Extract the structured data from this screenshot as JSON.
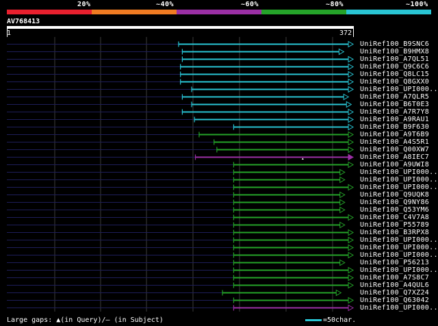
{
  "scale": {
    "labels": [
      "20%",
      "~40%",
      "~60%",
      "~80%",
      "~100%"
    ],
    "colors": [
      "#e8202e",
      "#f07b22",
      "#9a2fa4",
      "#25a329",
      "#29c5d4"
    ]
  },
  "query": {
    "title": "AV768413",
    "start": "1",
    "end": "372",
    "length": 372
  },
  "hits": [
    {
      "name": "UniRef100_B9SNC6",
      "start": 185,
      "end": 372,
      "color": "#29c5d4",
      "open": true
    },
    {
      "name": "UniRef100_B9HMX8",
      "start": 189,
      "end": 362,
      "color": "#29c5d4",
      "open": true
    },
    {
      "name": "UniRef100_A7QL51",
      "start": 189,
      "end": 372,
      "color": "#29c5d4",
      "open": true
    },
    {
      "name": "UniRef100_Q9C6C6",
      "start": 187,
      "end": 372,
      "color": "#29c5d4",
      "open": true
    },
    {
      "name": "UniRef100_Q8LC15",
      "start": 187,
      "end": 372,
      "color": "#29c5d4",
      "open": true
    },
    {
      "name": "UniRef100_Q8GXX0",
      "start": 187,
      "end": 372,
      "color": "#29c5d4",
      "open": true
    },
    {
      "name": "UniRef100_UPI000..",
      "start": 199,
      "end": 372,
      "color": "#29c5d4",
      "open": true
    },
    {
      "name": "UniRef100_A7QLR5",
      "start": 189,
      "end": 367,
      "color": "#29c5d4",
      "open": true
    },
    {
      "name": "UniRef100_B6T0E3",
      "start": 199,
      "end": 370,
      "color": "#29c5d4",
      "open": true
    },
    {
      "name": "UniRef100_A7R7Y8",
      "start": 189,
      "end": 372,
      "color": "#29c5d4",
      "open": true
    },
    {
      "name": "UniRef100_A9RAU1",
      "start": 202,
      "end": 372,
      "color": "#29c5d4",
      "open": true
    },
    {
      "name": "UniRef100_B9F630",
      "start": 244,
      "end": 372,
      "color": "#29c5d4",
      "open": true
    },
    {
      "name": "UniRef100_A9T6B9",
      "start": 207,
      "end": 372,
      "color": "#25a329",
      "open": true
    },
    {
      "name": "UniRef100_A4S5R1",
      "start": 223,
      "end": 372,
      "color": "#25a329",
      "open": true
    },
    {
      "name": "UniRef100_Q00XW7",
      "start": 226,
      "end": 372,
      "color": "#25a329",
      "open": true
    },
    {
      "name": "UniRef100_A8IEC7",
      "start": 203,
      "end": 372,
      "color": "#9a2fa4",
      "open": false,
      "gap": 318
    },
    {
      "name": "UniRef100_A9UWI8",
      "start": 244,
      "end": 372,
      "color": "#25a329",
      "open": true
    },
    {
      "name": "UniRef100_UPI000..",
      "start": 244,
      "end": 363,
      "color": "#25a329",
      "open": true
    },
    {
      "name": "UniRef100_UPI000..",
      "start": 244,
      "end": 363,
      "color": "#25a329",
      "open": true
    },
    {
      "name": "UniRef100_UPI000..",
      "start": 244,
      "end": 372,
      "color": "#25a329",
      "open": true
    },
    {
      "name": "UniRef100_Q9UQK8",
      "start": 244,
      "end": 363,
      "color": "#25a329",
      "open": true
    },
    {
      "name": "UniRef100_Q9NY86",
      "start": 244,
      "end": 363,
      "color": "#25a329",
      "open": true
    },
    {
      "name": "UniRef100_Q53YM6",
      "start": 244,
      "end": 363,
      "color": "#25a329",
      "open": true
    },
    {
      "name": "UniRef100_C4V7A8",
      "start": 244,
      "end": 372,
      "color": "#25a329",
      "open": true
    },
    {
      "name": "UniRef100_P55789",
      "start": 244,
      "end": 363,
      "color": "#25a329",
      "open": true
    },
    {
      "name": "UniRef100_B3RPX8",
      "start": 244,
      "end": 372,
      "color": "#25a329",
      "open": true
    },
    {
      "name": "UniRef100_UPI000..",
      "start": 244,
      "end": 372,
      "color": "#25a329",
      "open": true
    },
    {
      "name": "UniRef100_UPI000..",
      "start": 244,
      "end": 372,
      "color": "#25a329",
      "open": true
    },
    {
      "name": "UniRef100_UPI000..",
      "start": 244,
      "end": 372,
      "color": "#25a329",
      "open": true
    },
    {
      "name": "UniRef100_P56213",
      "start": 244,
      "end": 363,
      "color": "#25a329",
      "open": true
    },
    {
      "name": "UniRef100_UPI000..",
      "start": 244,
      "end": 372,
      "color": "#25a329",
      "open": true
    },
    {
      "name": "UniRef100_A7S8C7",
      "start": 244,
      "end": 372,
      "color": "#25a329",
      "open": true
    },
    {
      "name": "UniRef100_A4QUL6",
      "start": 244,
      "end": 372,
      "color": "#25a329",
      "open": true
    },
    {
      "name": "UniRef100_Q7XZ24",
      "start": 232,
      "end": 359,
      "color": "#25a329",
      "open": true
    },
    {
      "name": "UniRef100_Q63042",
      "start": 244,
      "end": 372,
      "color": "#25a329",
      "open": true
    },
    {
      "name": "UniRef100_UPI000..",
      "start": 244,
      "end": 372,
      "color": "#9a2fa4",
      "open": true
    }
  ],
  "legend": {
    "text": "Large gaps: ▲(in Query)/— (in Subject)",
    "scale_text": "=50char.",
    "scale_color": "#29c5d4",
    "gap_marker_color": "#ffffff",
    "grid_color": "#3c3c3c",
    "unaligned_color": "#1e1e5a"
  }
}
